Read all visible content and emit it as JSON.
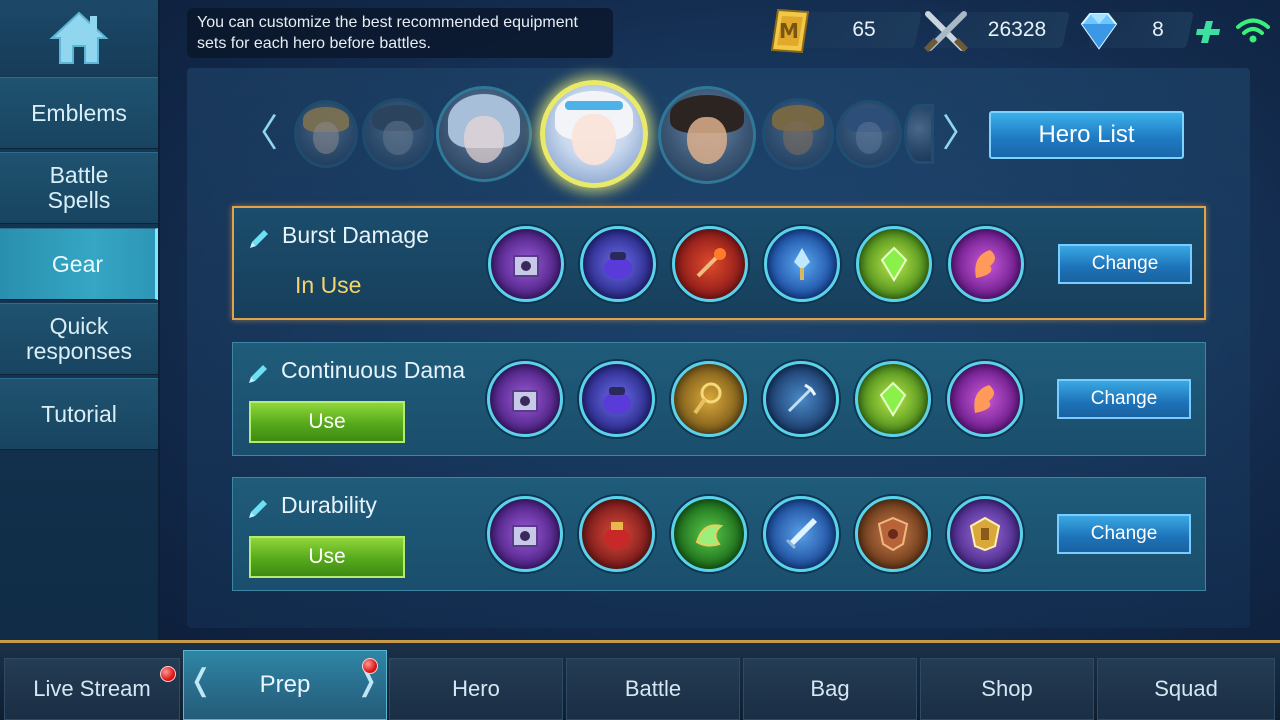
{
  "tip": "You can customize the best recommended equipment sets for each hero before battles.",
  "currency": {
    "tickets": "65",
    "battle_points": "26328",
    "diamonds": "8"
  },
  "sidebar": {
    "items": [
      {
        "label": "Emblems"
      },
      {
        "label": "Battle Spells"
      },
      {
        "label": "Gear",
        "active": true
      },
      {
        "label": "Quick responses"
      },
      {
        "label": "Tutorial"
      }
    ]
  },
  "hero_carousel": {
    "prev_arrow": "〈",
    "next_arrow": "〉",
    "hero_list_label": "Hero List"
  },
  "gear_sets": [
    {
      "name": "Burst Damage",
      "status": "In Use",
      "change_label": "Change",
      "items": [
        "gem-box-icon",
        "purple-bag-icon",
        "flame-staff-icon",
        "ice-crystal-wand-icon",
        "green-crystal-icon",
        "phoenix-feather-icon"
      ]
    },
    {
      "name": "Continuous Dama",
      "action_label": "Use",
      "change_label": "Change",
      "items": [
        "gem-box-icon",
        "purple-bag-icon",
        "golden-scepter-icon",
        "trident-icon",
        "green-crystal-icon",
        "phoenix-feather-icon"
      ]
    },
    {
      "name": "Durability",
      "action_label": "Use",
      "change_label": "Change",
      "items": [
        "gem-box-icon",
        "red-pouch-icon",
        "jade-dragon-icon",
        "ice-sword-icon",
        "bronze-shield-icon",
        "golden-shield-icon"
      ]
    }
  ],
  "bottom_nav": {
    "tabs": [
      {
        "label": "Live Stream"
      },
      {
        "label": "Prep",
        "active": true
      },
      {
        "label": "Hero"
      },
      {
        "label": "Battle"
      },
      {
        "label": "Bag"
      },
      {
        "label": "Shop"
      },
      {
        "label": "Squad"
      }
    ]
  },
  "colors": {
    "accent_gold": "#e0a24a",
    "in_use_text": "#f4d56a",
    "use_green": "#56a91c",
    "change_blue": "#1d72b8",
    "item_ring": "#5ad2ea"
  }
}
